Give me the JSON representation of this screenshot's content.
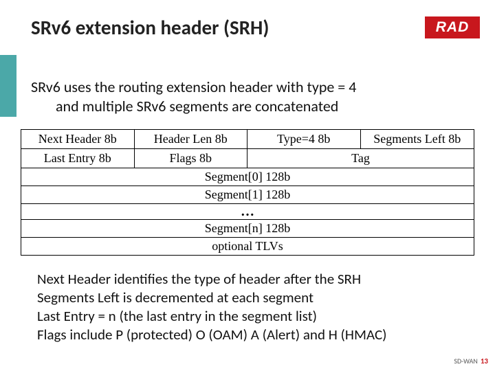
{
  "brand": {
    "logo_text": "RAD"
  },
  "title": "SRv6 extension header (SRH)",
  "intro": {
    "line1": "SRv6 uses the routing extension header with type = 4",
    "line2": "and multiple SRv6 segments are concatenated"
  },
  "header_layout": {
    "row1": {
      "c1": "Next Header 8b",
      "c2": "Header Len 8b",
      "c3": "Type=4  8b",
      "c4": "Segments Left 8b"
    },
    "row2": {
      "c1": "Last Entry 8b",
      "c2": "Flags 8b",
      "c3": "Tag"
    },
    "seg0": "Segment[0]  128b",
    "seg1": "Segment[1]  128b",
    "ellipsis": "…",
    "segn": "Segment[n]  128b",
    "tlvs": "optional TLVs"
  },
  "desc": {
    "l1": "Next Header identifies the type of header after the SRH",
    "l2": "Segments Left is decremented at each segment",
    "l3": "Last Entry = n (the last entry in the segment list)",
    "l4": "Flags include P (protected) O (OAM) A (Alert) and H (HMAC)"
  },
  "footer": {
    "label": "SD-WAN",
    "page": "13"
  }
}
